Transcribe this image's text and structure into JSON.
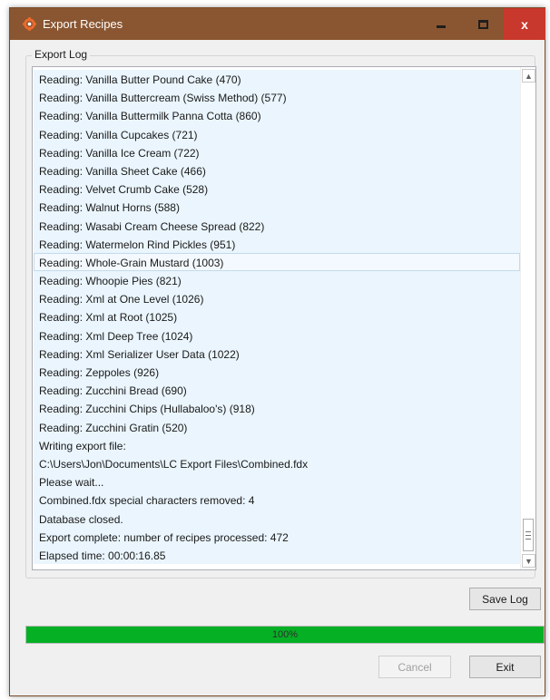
{
  "window": {
    "title": "Export Recipes",
    "controls": {
      "minimize": "minimize",
      "maximize": "maximize",
      "close": "x"
    },
    "title_bar_color": "#8a5631",
    "close_color": "#c8382c"
  },
  "log": {
    "group_label": "Export Log",
    "selected_index": 10,
    "lines": [
      "Reading: Vanilla Butter Pound Cake (470)",
      "Reading: Vanilla Buttercream (Swiss Method) (577)",
      "Reading: Vanilla Buttermilk Panna Cotta (860)",
      "Reading: Vanilla Cupcakes (721)",
      "Reading: Vanilla Ice Cream (722)",
      "Reading: Vanilla Sheet Cake (466)",
      "Reading: Velvet Crumb Cake (528)",
      "Reading: Walnut Horns (588)",
      "Reading: Wasabi Cream Cheese Spread (822)",
      "Reading: Watermelon Rind Pickles (951)",
      "Reading: Whole-Grain Mustard (1003)",
      "Reading: Whoopie Pies (821)",
      "Reading: Xml at One Level (1026)",
      "Reading: Xml at Root (1025)",
      "Reading: Xml Deep Tree (1024)",
      "Reading: Xml Serializer User Data (1022)",
      "Reading: Zeppoles (926)",
      "Reading: Zucchini Bread (690)",
      "Reading: Zucchini Chips (Hullabaloo's) (918)",
      "Reading: Zucchini Gratin (520)",
      "Writing export file:",
      "C:\\Users\\Jon\\Documents\\LC Export Files\\Combined.fdx",
      "Please wait...",
      "Combined.fdx special characters removed: 4",
      "Database closed.",
      "Export complete: number of recipes processed: 472",
      "Elapsed time: 00:00:16.85"
    ]
  },
  "progress": {
    "value": 1.0,
    "label": "100%",
    "color": "#06b025"
  },
  "buttons": {
    "save_log": "Save Log",
    "cancel": "Cancel",
    "exit": "Exit"
  }
}
